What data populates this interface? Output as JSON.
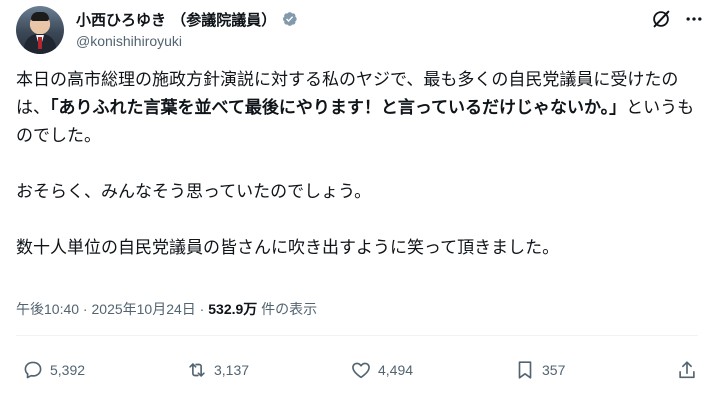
{
  "author": {
    "display_name": "小西ひろゆき （参議院議員）",
    "handle": "@konishihiroyuki"
  },
  "icons": {
    "verified": "verified-badge-icon",
    "grok": "grok-icon",
    "more": "more-icon"
  },
  "post": {
    "p1_a": "本日の高市総理の施政方針演説に対する私のヤジで、最も多くの自民党議員に受けたのは、",
    "p1_bold": "「ありふれた言葉を並べて最後にやります！と言っているだけじゃないか。」",
    "p1_c": "というものでした。",
    "p2": "おそらく、みんなそう思っていたのでしょう。",
    "p3": "数十人単位の自民党議員の皆さんに吹き出すように笑って頂きました。"
  },
  "meta": {
    "time": "午後10:40",
    "separator": " · ",
    "date": "2025年10月24日",
    "separator2": " · ",
    "views": "532.9万",
    "views_label": " 件の表示"
  },
  "actions": {
    "replies": "5,392",
    "reposts": "3,137",
    "likes": "4,494",
    "bookmarks": "357"
  },
  "colors": {
    "text": "#0f1419",
    "secondary": "#536471",
    "verified": "#829aab"
  }
}
